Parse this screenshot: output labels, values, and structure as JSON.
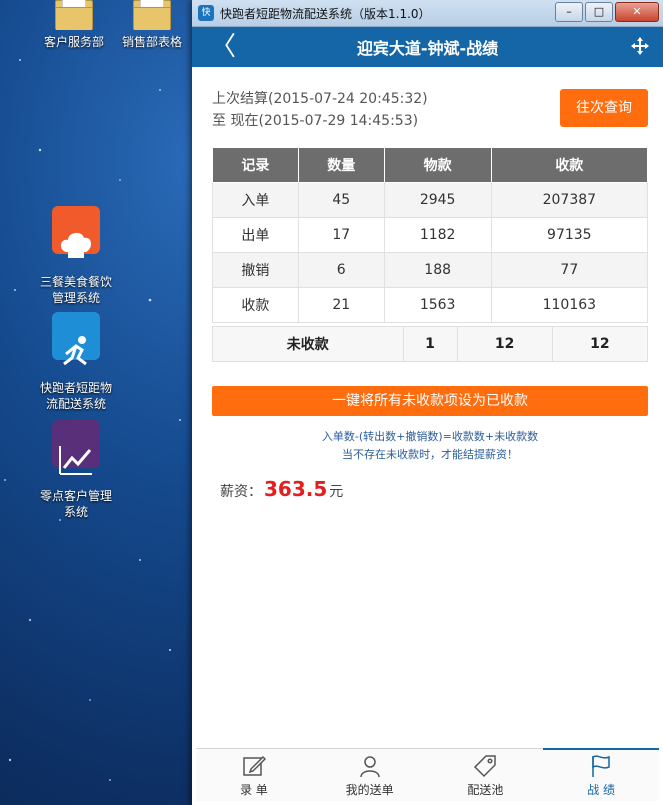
{
  "desktop": {
    "icons": [
      {
        "label": "客户服务部",
        "icon": "folder-icon"
      },
      {
        "label": "销售部表格",
        "icon": "folder-icon"
      },
      {
        "label": "三餐美食餐饮\n管理系统",
        "icon": "chef-hat-icon"
      },
      {
        "label": "快跑者短距物\n流配送系统",
        "icon": "runner-icon"
      },
      {
        "label": "零点客户管理\n系统",
        "icon": "chart-icon"
      }
    ]
  },
  "window": {
    "title": "快跑者短距物流配送系统（版本1.1.0）",
    "app_icon_text": "快"
  },
  "nav": {
    "title": "迎宾大道-钟斌-战绩",
    "back_glyph": "〈"
  },
  "period": {
    "last": "上次结算(2015-07-24 20:45:32)",
    "to": "至  现在(2015-07-29 14:45:53)"
  },
  "query_button": "往次查询",
  "stats_table": {
    "headers": [
      "记录",
      "数量",
      "物款",
      "收款"
    ],
    "rows": [
      [
        "入单",
        "45",
        "2945",
        "207387"
      ],
      [
        "出单",
        "17",
        "1182",
        "97135"
      ],
      [
        "撤销",
        "6",
        "188",
        "77"
      ],
      [
        "收款",
        "21",
        "1563",
        "110163"
      ]
    ]
  },
  "unpaid": [
    "未收款",
    "1",
    "12",
    "12"
  ],
  "settle_button": "一键将所有未收款项设为已收款",
  "formula": {
    "line1": "入单数-(转出数+撤销数)=收款数+未收款数",
    "line2": "当不存在未收款时，才能结提薪资！"
  },
  "salary": {
    "label": "薪资：",
    "amount": "363.5",
    "unit": "元"
  },
  "tabs": [
    {
      "label": "录 单",
      "icon": "edit-icon"
    },
    {
      "label": "我的送单",
      "icon": "user-icon"
    },
    {
      "label": "配送池",
      "icon": "tag-icon"
    },
    {
      "label": "战 绩",
      "icon": "flag-icon",
      "active": true
    }
  ],
  "colors": {
    "accent": "#1466a6",
    "orange": "#ff6d0e",
    "salary": "#e02020"
  }
}
